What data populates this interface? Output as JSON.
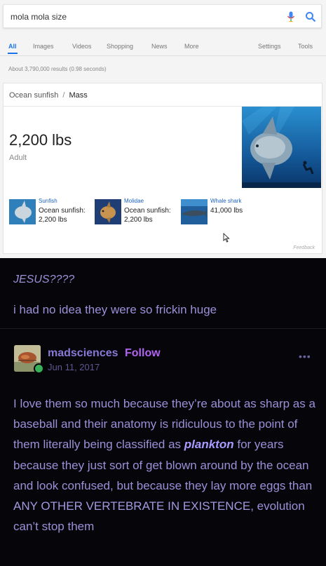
{
  "search": {
    "query": "mola mola size",
    "tabs": [
      {
        "label": "All",
        "active": true
      },
      {
        "label": "Images"
      },
      {
        "label": "Videos"
      },
      {
        "label": "Shopping"
      },
      {
        "label": "News"
      },
      {
        "label": "More"
      }
    ],
    "right_tabs": [
      "Settings",
      "Tools"
    ],
    "stats": "About 3,790,000 results (0.98 seconds)"
  },
  "knowledge": {
    "breadcrumb_parent": "Ocean sunfish",
    "breadcrumb_sep": "/",
    "breadcrumb_current": "Mass",
    "value": "2,200 lbs",
    "value_sub": "Adult",
    "related": [
      {
        "category": "Sunfish",
        "value": "Ocean sunfish: 2,200 lbs",
        "icon": "fish-thumbnail"
      },
      {
        "category": "Molidae",
        "value": "Ocean sunfish: 2,200 lbs",
        "icon": "fish-thumbnail"
      },
      {
        "category": "Whale shark",
        "value": "41,000 lbs",
        "icon": "shark-thumbnail"
      }
    ],
    "feedback": "Feedback"
  },
  "post": {
    "exclaim": "JESUS????",
    "reply": "i had no idea they were so frickin huge",
    "username": "madsciences",
    "follow": "Follow",
    "date": "Jun 11, 2017",
    "more": "•••",
    "body": [
      {
        "t": "I love them so much because they’re about as sharp as a baseball and their anatomy is ridiculous to the point of them literally being classified as "
      },
      {
        "t": "plankton",
        "style": "em"
      },
      {
        "t": " for years because they just sort of get blown around by the ocean and look confused, but because they lay more eggs than "
      },
      {
        "t": "ANY OTHER VERTEBRATE IN EXISTENCE",
        "style": "caps"
      },
      {
        "t": ", evolution can’t stop them"
      }
    ]
  },
  "colors": {
    "google_blue": "#1a73e8",
    "tumblr_text": "#9d8fd8",
    "follow": "#b363f1",
    "reblog_green": "#36b15a"
  }
}
